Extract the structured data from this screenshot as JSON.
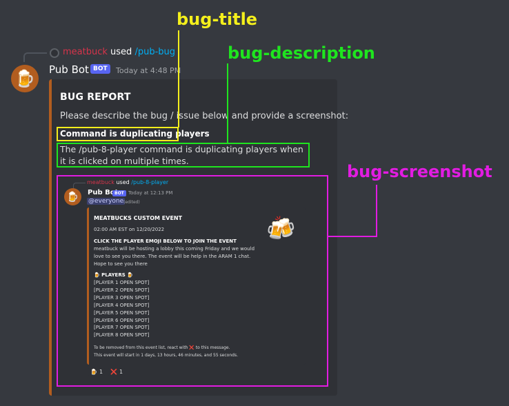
{
  "reply": {
    "user": "meatbuck",
    "used": "used",
    "command": "/pub-bug"
  },
  "message": {
    "avatar_emoji": "🍺",
    "username": "Pub Bot",
    "bot_tag": "BOT",
    "timestamp": "Today at 4:48 PM"
  },
  "embed": {
    "title": "BUG REPORT",
    "prompt": "Please describe the bug / issue below and provide a screenshot:",
    "bug_title": "Command is duplicating players",
    "bug_description": "The /pub-8-player command is duplicating players when it is clicked on multiple times.",
    "accent_color": "#b25d1f"
  },
  "annotations": {
    "bug_title_label": "bug-title",
    "bug_description_label": "bug-description",
    "bug_screenshot_label": "bug-screenshot",
    "colors": {
      "title": "#f4ef1c",
      "description": "#1fe51f",
      "screenshot": "#e21ce2"
    }
  },
  "screenshot": {
    "reply_user": "meatbuck",
    "reply_used": "used",
    "reply_command": "/pub-8-player",
    "username": "Pub Bot",
    "bot_tag": "BOT",
    "timestamp": "Today at 12:13 PM",
    "mention": "@everyone",
    "edited": "(edited)",
    "event_title": "MEATBUCKS CUSTOM EVENT",
    "event_time": "02:00 AM EST on 12/20/2022",
    "click_line": "CLICK THE PLAYER EMOJI BELOW TO JOIN THE EVENT",
    "body": "meatbuck will be hosting a lobby this coming Friday and we would love to see you there. The event will be help in the ARAM 1 chat. Hope to see you there",
    "beer_icon": "🍻",
    "players_heading": "🍺 PLAYERS 🍺",
    "players": [
      "[PLAYER 1 OPEN SPOT]",
      "[PLAYER 2 OPEN SPOT]",
      "[PLAYER 3 OPEN SPOT]",
      "[PLAYER 4 OPEN SPOT]",
      "[PLAYER 5 OPEN SPOT]",
      "[PLAYER 6 OPEN SPOT]",
      "[PLAYER 7 OPEN SPOT]",
      "[PLAYER 8 OPEN SPOT]"
    ],
    "footer_pre": "To be removed from this event list, react with",
    "footer_x": "❌",
    "footer_post": "to this message.",
    "footer_line2": "This event will start in 1 days, 13 hours, 46 minutes, and 55 seconds.",
    "reactions": [
      {
        "emoji": "🍺",
        "count": "1"
      },
      {
        "emoji": "❌",
        "count": "1"
      }
    ]
  }
}
